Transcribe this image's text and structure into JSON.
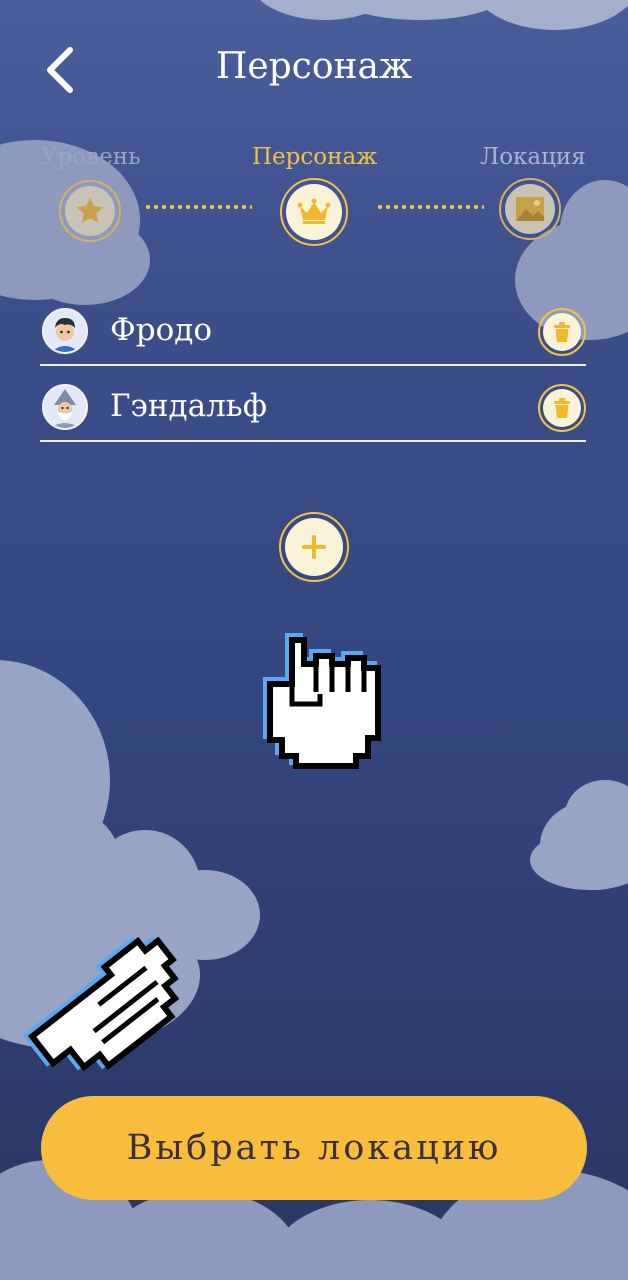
{
  "header": {
    "title": "Персонаж",
    "back_icon": "chevron-left-icon"
  },
  "steps": [
    {
      "label": "Уровень",
      "icon": "star-icon",
      "state": "done"
    },
    {
      "label": "Персонаж",
      "icon": "crown-icon",
      "state": "active"
    },
    {
      "label": "Локация",
      "icon": "landscape-icon",
      "state": "pending"
    }
  ],
  "characters": [
    {
      "name": "Фродо",
      "avatar": "frodo-avatar",
      "action_icon": "trash-icon"
    },
    {
      "name": "Гэндальф",
      "avatar": "gandalf-avatar",
      "action_icon": "trash-icon"
    }
  ],
  "add_button": {
    "icon": "plus-icon"
  },
  "primary_button": {
    "label": "Выбрать локацию"
  },
  "overlay": {
    "cursor_icons": [
      "grab-hand-cursor-icon",
      "pointing-hand-cursor-icon"
    ]
  },
  "colors": {
    "accent": "#f2c244",
    "primary_button": "#f8bd3c",
    "background_top": "#4a5e9c",
    "background_bottom": "#283660",
    "step_inactive_text": "#aab3d2",
    "cloud": "#98a4c4"
  }
}
